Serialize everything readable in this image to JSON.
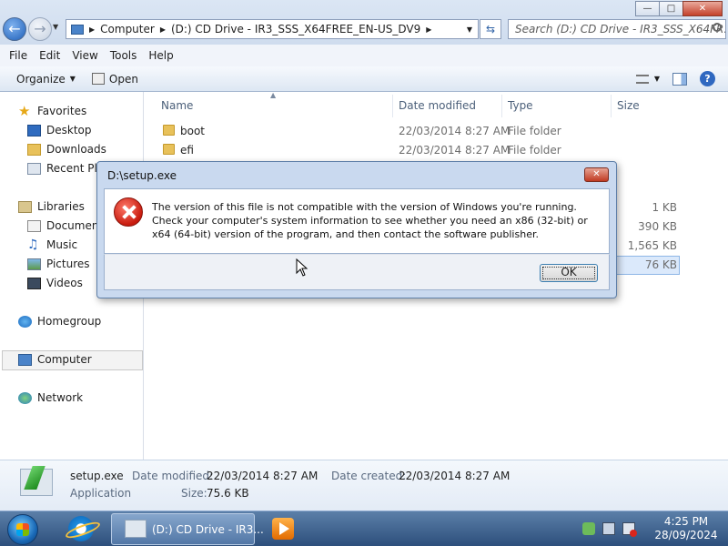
{
  "address_bar": {
    "segments": [
      "Computer",
      "(D:) CD Drive - IR3_SSS_X64FREE_EN-US_DV9"
    ],
    "search_placeholder": "Search (D:) CD Drive - IR3_SSS_X64FR..."
  },
  "menu": [
    "File",
    "Edit",
    "View",
    "Tools",
    "Help"
  ],
  "toolbar": {
    "organize": "Organize",
    "open": "Open"
  },
  "nav": {
    "favorites": "Favorites",
    "desktop": "Desktop",
    "downloads": "Downloads",
    "recent": "Recent Places",
    "libraries": "Libraries",
    "documents": "Documents",
    "music": "Music",
    "pictures": "Pictures",
    "videos": "Videos",
    "homegroup": "Homegroup",
    "computer": "Computer",
    "network": "Network"
  },
  "columns": {
    "name": "Name",
    "date": "Date modified",
    "type": "Type",
    "size": "Size"
  },
  "files": [
    {
      "name": "boot",
      "date": "22/03/2014 8:27 AM",
      "type": "File folder"
    },
    {
      "name": "efi",
      "date": "22/03/2014 8:27 AM",
      "type": "File folder"
    }
  ],
  "hidden_sizes": [
    "1 KB",
    "390 KB",
    "1,565 KB",
    "76 KB"
  ],
  "details": {
    "filename": "setup.exe",
    "filetype": "Application",
    "date_modified_label": "Date modified:",
    "date_modified": "22/03/2014 8:27 AM",
    "date_created_label": "Date created:",
    "date_created": "22/03/2014 8:27 AM",
    "size_label": "Size:",
    "size": "75.6 KB"
  },
  "dialog": {
    "title": "D:\\setup.exe",
    "message": "The version of this file is not compatible with the version of Windows you're running. Check your computer's system information to see whether you need an x86 (32-bit) or x64 (64-bit) version of the program, and then contact the software publisher.",
    "ok": "OK"
  },
  "taskbar": {
    "explorer_label": "(D:) CD Drive - IR3...",
    "time": "4:25 PM",
    "date": "28/09/2024"
  },
  "colors": {
    "error_red": "#c81b0e",
    "selection_blue": "#dbe9fb",
    "taskbar": "#2d4f7c"
  }
}
